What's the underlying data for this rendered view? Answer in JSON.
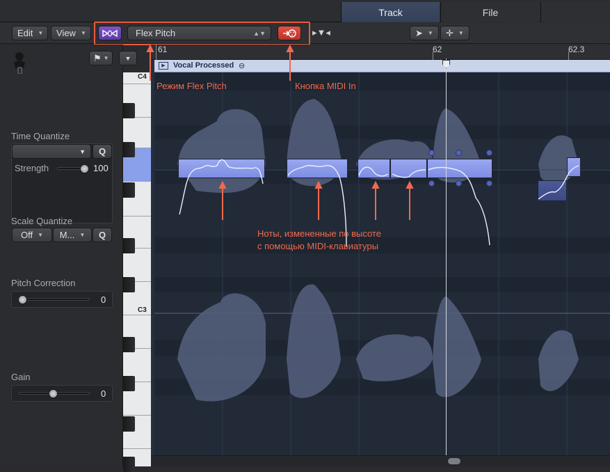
{
  "tabs": {
    "track": "Track",
    "file": "File"
  },
  "toolbar": {
    "edit": "Edit",
    "view": "View",
    "flex_mode": "Flex Pitch",
    "tool_pointer": "pointer-tool",
    "tool_crosshair": "marquee-tool"
  },
  "ruler": {
    "bar_61": "61",
    "bar_62": "62",
    "bar_62_3": "62.3"
  },
  "region": {
    "name": "Vocal Processed"
  },
  "piano": {
    "c4": "C4",
    "c3": "C3"
  },
  "inspector": {
    "time_quantize": {
      "label": "Time Quantize",
      "value": "",
      "q": "Q",
      "strength_label": "Strength",
      "strength_value": "100"
    },
    "scale_quantize": {
      "label": "Scale Quantize",
      "root": "Off",
      "scale": "M...",
      "q": "Q"
    },
    "pitch_correction": {
      "label": "Pitch Correction",
      "value": "0"
    },
    "gain": {
      "label": "Gain",
      "value": "0"
    }
  },
  "annotations": {
    "flex_pitch_mode": "Режим Flex Pitch",
    "midi_in_button": "Кнопка MIDI In",
    "notes_line1": "Ноты, измененные по высоте",
    "notes_line2": "с помощью MIDI-клавиатуры"
  },
  "colors": {
    "accent_annotation": "#f06a4e",
    "note_fill": "#8a99ea",
    "tab_active": "#3a475e"
  }
}
